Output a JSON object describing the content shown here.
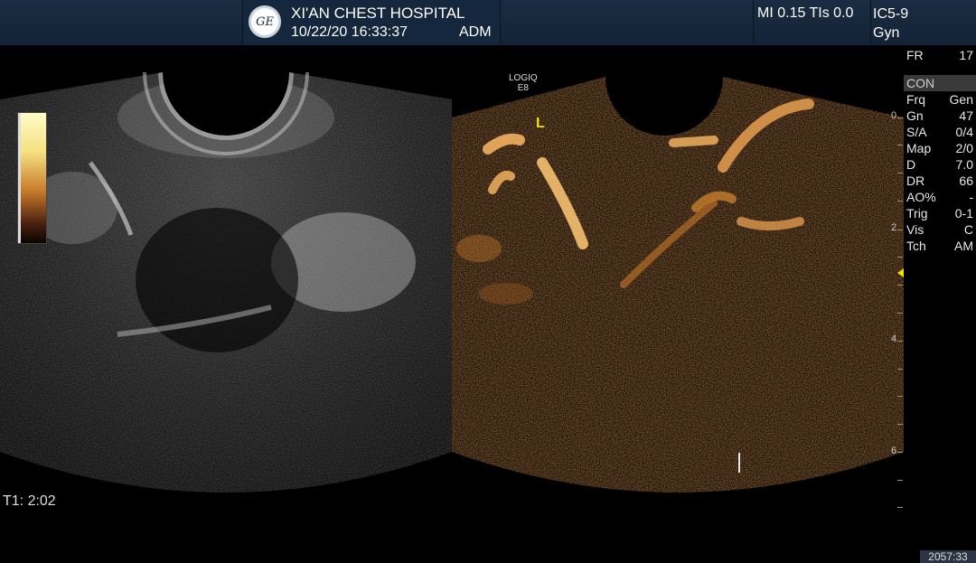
{
  "header": {
    "logo_text": "GE",
    "hospital": "XI'AN CHEST HOSPITAL",
    "datetime": "10/22/20 16:33:37",
    "operator": "ADM",
    "mi_tis": "MI 0.15  TIs 0.0",
    "probe": "IC5-9",
    "preset": "Gyn"
  },
  "params": {
    "fr_label": "FR",
    "fr_value": "17",
    "mode": "CON",
    "rows": [
      {
        "label": "Frq",
        "value": "Gen"
      },
      {
        "label": "Gn",
        "value": "47"
      },
      {
        "label": "S/A",
        "value": "0/4"
      },
      {
        "label": "Map",
        "value": "2/0"
      },
      {
        "label": "D",
        "value": "7.0"
      },
      {
        "label": "DR",
        "value": "66"
      },
      {
        "label": "AO%",
        "value": "-"
      },
      {
        "label": "Trig",
        "value": "0-1"
      },
      {
        "label": "Vis",
        "value": "C"
      },
      {
        "label": "Tch",
        "value": "AM"
      }
    ]
  },
  "image": {
    "system_label_1": "LOGIQ",
    "system_label_2": "E8",
    "orientation_marker": "L",
    "timer": "T1: 2:02",
    "frame_counter": "2057:33"
  },
  "depth_scale": {
    "labels": [
      "0",
      "2",
      "4",
      "6"
    ]
  },
  "colors": {
    "header_bg": "#1a2c42",
    "contrast_map": "#d98a30",
    "marker_yellow": "#f0e000"
  }
}
